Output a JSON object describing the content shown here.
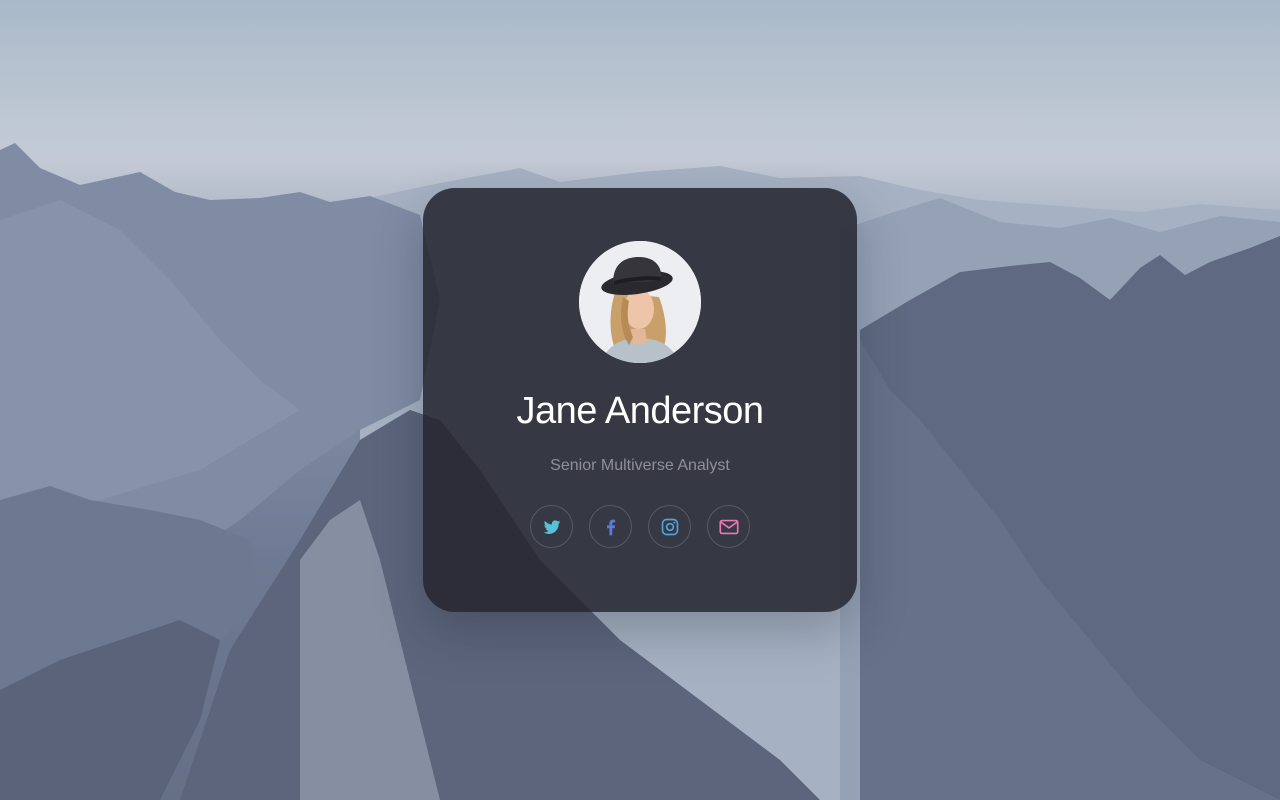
{
  "profile": {
    "name": "Jane Anderson",
    "title": "Senior Multiverse Analyst"
  },
  "social_links": [
    {
      "icon": "twitter-icon",
      "color": "#56c2d6"
    },
    {
      "icon": "facebook-icon",
      "color": "#5b7bd5"
    },
    {
      "icon": "instagram-icon",
      "color": "#4fa3d9"
    },
    {
      "icon": "mail-icon",
      "color": "#e979b4"
    }
  ],
  "colors": {
    "card_background": "#24242e",
    "name_text": "#ffffff",
    "title_text": "#8f8f9b"
  }
}
